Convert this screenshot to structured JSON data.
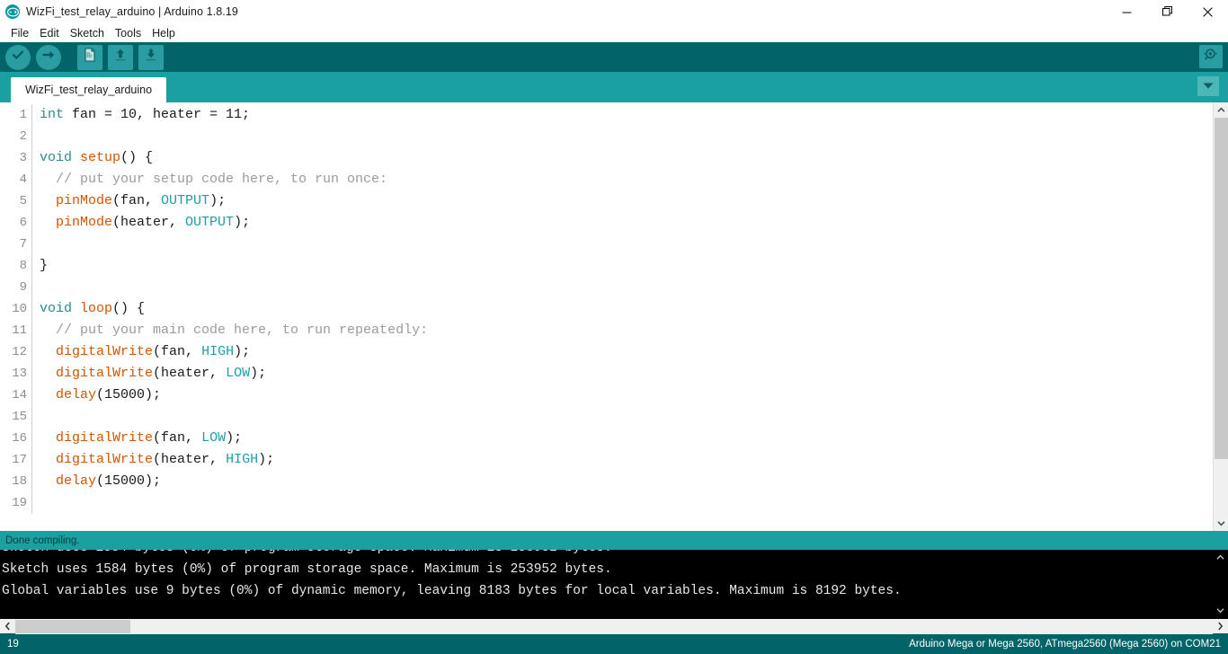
{
  "window": {
    "title": "WizFi_test_relay_arduino | Arduino 1.8.19",
    "logo_icon": "arduino-logo-icon",
    "controls": {
      "minimize": "minimize-icon",
      "restore": "restore-icon",
      "close": "close-icon"
    }
  },
  "menubar": {
    "items": [
      "File",
      "Edit",
      "Sketch",
      "Tools",
      "Help"
    ]
  },
  "toolbar": {
    "verify_label": "verify-icon",
    "upload_label": "upload-icon",
    "new_label": "new-icon",
    "open_label": "open-icon",
    "save_label": "save-icon",
    "serial_monitor_label": "serial-monitor-icon",
    "bg_color": "#006468",
    "button_color": "#2a9da2"
  },
  "tabs": {
    "active": "WizFi_test_relay_arduino",
    "menu_icon": "chevron-down-icon",
    "bar_color": "#19a0a0"
  },
  "editor": {
    "lines": [
      {
        "num": "1",
        "tokens": [
          {
            "t": "int",
            "c": "kw"
          },
          {
            "t": " fan = 10, heater = 11;",
            "c": "pl"
          }
        ]
      },
      {
        "num": "2",
        "tokens": []
      },
      {
        "num": "3",
        "tokens": [
          {
            "t": "void",
            "c": "kw"
          },
          {
            "t": " ",
            "c": "pl"
          },
          {
            "t": "setup",
            "c": "fn"
          },
          {
            "t": "() {",
            "c": "pl"
          }
        ]
      },
      {
        "num": "4",
        "tokens": [
          {
            "t": "  // put your setup code here, to run once:",
            "c": "cm"
          }
        ]
      },
      {
        "num": "5",
        "tokens": [
          {
            "t": "  ",
            "c": "pl"
          },
          {
            "t": "pinMode",
            "c": "fn"
          },
          {
            "t": "(fan, ",
            "c": "pl"
          },
          {
            "t": "OUTPUT",
            "c": "cst"
          },
          {
            "t": ");",
            "c": "pl"
          }
        ]
      },
      {
        "num": "6",
        "tokens": [
          {
            "t": "  ",
            "c": "pl"
          },
          {
            "t": "pinMode",
            "c": "fn"
          },
          {
            "t": "(heater, ",
            "c": "pl"
          },
          {
            "t": "OUTPUT",
            "c": "cst"
          },
          {
            "t": ");",
            "c": "pl"
          }
        ]
      },
      {
        "num": "7",
        "tokens": []
      },
      {
        "num": "8",
        "tokens": [
          {
            "t": "}",
            "c": "pl"
          }
        ]
      },
      {
        "num": "9",
        "tokens": []
      },
      {
        "num": "10",
        "tokens": [
          {
            "t": "void",
            "c": "kw"
          },
          {
            "t": " ",
            "c": "pl"
          },
          {
            "t": "loop",
            "c": "fn"
          },
          {
            "t": "() {",
            "c": "pl"
          }
        ]
      },
      {
        "num": "11",
        "tokens": [
          {
            "t": "  // put your main code here, to run repeatedly:",
            "c": "cm"
          }
        ]
      },
      {
        "num": "12",
        "tokens": [
          {
            "t": "  ",
            "c": "pl"
          },
          {
            "t": "digitalWrite",
            "c": "fn"
          },
          {
            "t": "(fan, ",
            "c": "pl"
          },
          {
            "t": "HIGH",
            "c": "cst"
          },
          {
            "t": ");",
            "c": "pl"
          }
        ]
      },
      {
        "num": "13",
        "tokens": [
          {
            "t": "  ",
            "c": "pl"
          },
          {
            "t": "digitalWrite",
            "c": "fn"
          },
          {
            "t": "(heater, ",
            "c": "pl"
          },
          {
            "t": "LOW",
            "c": "cst"
          },
          {
            "t": ");",
            "c": "pl"
          }
        ]
      },
      {
        "num": "14",
        "tokens": [
          {
            "t": "  ",
            "c": "pl"
          },
          {
            "t": "delay",
            "c": "fn"
          },
          {
            "t": "(15000);",
            "c": "pl"
          }
        ]
      },
      {
        "num": "15",
        "tokens": []
      },
      {
        "num": "16",
        "tokens": [
          {
            "t": "  ",
            "c": "pl"
          },
          {
            "t": "digitalWrite",
            "c": "fn"
          },
          {
            "t": "(fan, ",
            "c": "pl"
          },
          {
            "t": "LOW",
            "c": "cst"
          },
          {
            "t": ");",
            "c": "pl"
          }
        ]
      },
      {
        "num": "17",
        "tokens": [
          {
            "t": "  ",
            "c": "pl"
          },
          {
            "t": "digitalWrite",
            "c": "fn"
          },
          {
            "t": "(heater, ",
            "c": "pl"
          },
          {
            "t": "HIGH",
            "c": "cst"
          },
          {
            "t": ");",
            "c": "pl"
          }
        ]
      },
      {
        "num": "18",
        "tokens": [
          {
            "t": "  ",
            "c": "pl"
          },
          {
            "t": "delay",
            "c": "fn"
          },
          {
            "t": "(15000);",
            "c": "pl"
          }
        ]
      },
      {
        "num": "19",
        "tokens": []
      }
    ]
  },
  "status_message": "Done compiling.",
  "console": {
    "clipped_line": "Sketch uses 1584 bytes (0%) of program storage space. Maximum is 253952 bytes.",
    "lines": [
      "Sketch uses 1584 bytes (0%) of program storage space. Maximum is 253952 bytes.",
      "Global variables use 9 bytes (0%) of dynamic memory, leaving 8183 bytes for local variables. Maximum is 8192 bytes."
    ]
  },
  "statusbar": {
    "line_number": "19",
    "board": "Arduino Mega or Mega 2560, ATmega2560 (Mega 2560) on COM21",
    "bg_color": "#006468"
  }
}
